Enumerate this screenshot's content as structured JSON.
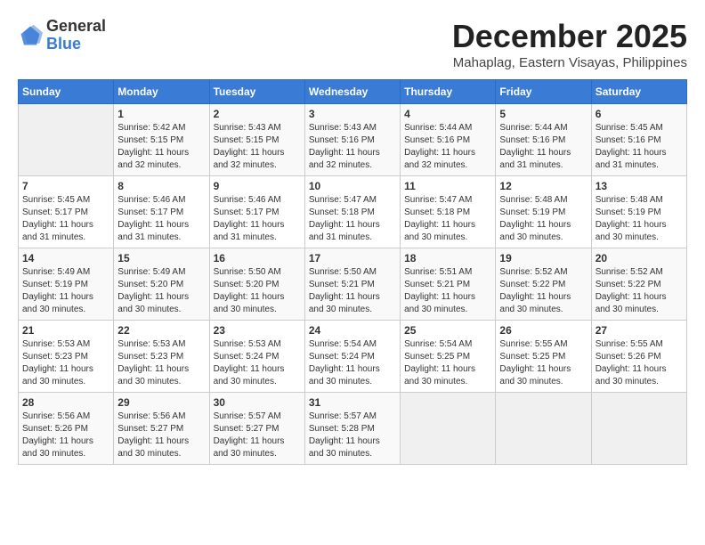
{
  "header": {
    "logo_general": "General",
    "logo_blue": "Blue",
    "month_year": "December 2025",
    "location": "Mahaplag, Eastern Visayas, Philippines"
  },
  "calendar": {
    "days_of_week": [
      "Sunday",
      "Monday",
      "Tuesday",
      "Wednesday",
      "Thursday",
      "Friday",
      "Saturday"
    ],
    "weeks": [
      [
        {
          "day": "",
          "sunrise": "",
          "sunset": "",
          "daylight": "",
          "empty": true
        },
        {
          "day": "1",
          "sunrise": "Sunrise: 5:42 AM",
          "sunset": "Sunset: 5:15 PM",
          "daylight": "Daylight: 11 hours and 32 minutes."
        },
        {
          "day": "2",
          "sunrise": "Sunrise: 5:43 AM",
          "sunset": "Sunset: 5:15 PM",
          "daylight": "Daylight: 11 hours and 32 minutes."
        },
        {
          "day": "3",
          "sunrise": "Sunrise: 5:43 AM",
          "sunset": "Sunset: 5:16 PM",
          "daylight": "Daylight: 11 hours and 32 minutes."
        },
        {
          "day": "4",
          "sunrise": "Sunrise: 5:44 AM",
          "sunset": "Sunset: 5:16 PM",
          "daylight": "Daylight: 11 hours and 32 minutes."
        },
        {
          "day": "5",
          "sunrise": "Sunrise: 5:44 AM",
          "sunset": "Sunset: 5:16 PM",
          "daylight": "Daylight: 11 hours and 31 minutes."
        },
        {
          "day": "6",
          "sunrise": "Sunrise: 5:45 AM",
          "sunset": "Sunset: 5:16 PM",
          "daylight": "Daylight: 11 hours and 31 minutes."
        }
      ],
      [
        {
          "day": "7",
          "sunrise": "Sunrise: 5:45 AM",
          "sunset": "Sunset: 5:17 PM",
          "daylight": "Daylight: 11 hours and 31 minutes."
        },
        {
          "day": "8",
          "sunrise": "Sunrise: 5:46 AM",
          "sunset": "Sunset: 5:17 PM",
          "daylight": "Daylight: 11 hours and 31 minutes."
        },
        {
          "day": "9",
          "sunrise": "Sunrise: 5:46 AM",
          "sunset": "Sunset: 5:17 PM",
          "daylight": "Daylight: 11 hours and 31 minutes."
        },
        {
          "day": "10",
          "sunrise": "Sunrise: 5:47 AM",
          "sunset": "Sunset: 5:18 PM",
          "daylight": "Daylight: 11 hours and 31 minutes."
        },
        {
          "day": "11",
          "sunrise": "Sunrise: 5:47 AM",
          "sunset": "Sunset: 5:18 PM",
          "daylight": "Daylight: 11 hours and 30 minutes."
        },
        {
          "day": "12",
          "sunrise": "Sunrise: 5:48 AM",
          "sunset": "Sunset: 5:19 PM",
          "daylight": "Daylight: 11 hours and 30 minutes."
        },
        {
          "day": "13",
          "sunrise": "Sunrise: 5:48 AM",
          "sunset": "Sunset: 5:19 PM",
          "daylight": "Daylight: 11 hours and 30 minutes."
        }
      ],
      [
        {
          "day": "14",
          "sunrise": "Sunrise: 5:49 AM",
          "sunset": "Sunset: 5:19 PM",
          "daylight": "Daylight: 11 hours and 30 minutes."
        },
        {
          "day": "15",
          "sunrise": "Sunrise: 5:49 AM",
          "sunset": "Sunset: 5:20 PM",
          "daylight": "Daylight: 11 hours and 30 minutes."
        },
        {
          "day": "16",
          "sunrise": "Sunrise: 5:50 AM",
          "sunset": "Sunset: 5:20 PM",
          "daylight": "Daylight: 11 hours and 30 minutes."
        },
        {
          "day": "17",
          "sunrise": "Sunrise: 5:50 AM",
          "sunset": "Sunset: 5:21 PM",
          "daylight": "Daylight: 11 hours and 30 minutes."
        },
        {
          "day": "18",
          "sunrise": "Sunrise: 5:51 AM",
          "sunset": "Sunset: 5:21 PM",
          "daylight": "Daylight: 11 hours and 30 minutes."
        },
        {
          "day": "19",
          "sunrise": "Sunrise: 5:52 AM",
          "sunset": "Sunset: 5:22 PM",
          "daylight": "Daylight: 11 hours and 30 minutes."
        },
        {
          "day": "20",
          "sunrise": "Sunrise: 5:52 AM",
          "sunset": "Sunset: 5:22 PM",
          "daylight": "Daylight: 11 hours and 30 minutes."
        }
      ],
      [
        {
          "day": "21",
          "sunrise": "Sunrise: 5:53 AM",
          "sunset": "Sunset: 5:23 PM",
          "daylight": "Daylight: 11 hours and 30 minutes."
        },
        {
          "day": "22",
          "sunrise": "Sunrise: 5:53 AM",
          "sunset": "Sunset: 5:23 PM",
          "daylight": "Daylight: 11 hours and 30 minutes."
        },
        {
          "day": "23",
          "sunrise": "Sunrise: 5:53 AM",
          "sunset": "Sunset: 5:24 PM",
          "daylight": "Daylight: 11 hours and 30 minutes."
        },
        {
          "day": "24",
          "sunrise": "Sunrise: 5:54 AM",
          "sunset": "Sunset: 5:24 PM",
          "daylight": "Daylight: 11 hours and 30 minutes."
        },
        {
          "day": "25",
          "sunrise": "Sunrise: 5:54 AM",
          "sunset": "Sunset: 5:25 PM",
          "daylight": "Daylight: 11 hours and 30 minutes."
        },
        {
          "day": "26",
          "sunrise": "Sunrise: 5:55 AM",
          "sunset": "Sunset: 5:25 PM",
          "daylight": "Daylight: 11 hours and 30 minutes."
        },
        {
          "day": "27",
          "sunrise": "Sunrise: 5:55 AM",
          "sunset": "Sunset: 5:26 PM",
          "daylight": "Daylight: 11 hours and 30 minutes."
        }
      ],
      [
        {
          "day": "28",
          "sunrise": "Sunrise: 5:56 AM",
          "sunset": "Sunset: 5:26 PM",
          "daylight": "Daylight: 11 hours and 30 minutes."
        },
        {
          "day": "29",
          "sunrise": "Sunrise: 5:56 AM",
          "sunset": "Sunset: 5:27 PM",
          "daylight": "Daylight: 11 hours and 30 minutes."
        },
        {
          "day": "30",
          "sunrise": "Sunrise: 5:57 AM",
          "sunset": "Sunset: 5:27 PM",
          "daylight": "Daylight: 11 hours and 30 minutes."
        },
        {
          "day": "31",
          "sunrise": "Sunrise: 5:57 AM",
          "sunset": "Sunset: 5:28 PM",
          "daylight": "Daylight: 11 hours and 30 minutes."
        },
        {
          "day": "",
          "sunrise": "",
          "sunset": "",
          "daylight": "",
          "empty": true
        },
        {
          "day": "",
          "sunrise": "",
          "sunset": "",
          "daylight": "",
          "empty": true
        },
        {
          "day": "",
          "sunrise": "",
          "sunset": "",
          "daylight": "",
          "empty": true
        }
      ]
    ]
  }
}
